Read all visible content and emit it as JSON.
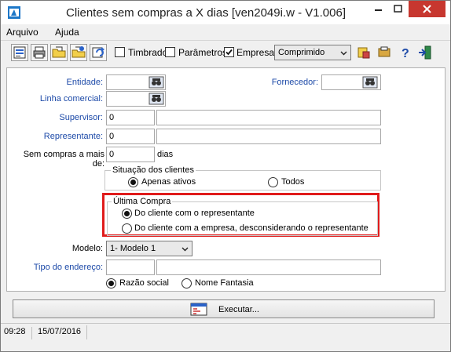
{
  "window": {
    "title": "Clientes sem compras a X dias [ven2049i.w - V1.006]"
  },
  "menu": {
    "items": [
      "Arquivo",
      "Ajuda"
    ]
  },
  "toolbar": {
    "timbrado_label": "Timbrado",
    "timbrado_checked": false,
    "parametros_label": "Parâmetros",
    "parametros_checked": false,
    "empresa_label": "Empresa",
    "empresa_checked": true,
    "format_select": "Comprimido"
  },
  "form": {
    "entidade_label": "Entidade:",
    "entidade_value": "",
    "fornecedor_label": "Fornecedor:",
    "fornecedor_value": "",
    "linha_label": "Linha comercial:",
    "linha_value": "",
    "supervisor_label": "Supervisor:",
    "supervisor_value": "0",
    "supervisor_desc": "",
    "representante_label": "Representante:",
    "representante_value": "0",
    "representante_desc": "",
    "sem_compras_label": "Sem compras a mais de:",
    "sem_compras_value": "0",
    "dias_label": "dias",
    "situacao_title": "Situação dos clientes",
    "situacao_options": [
      "Apenas ativos",
      "Todos"
    ],
    "ultima_title": "Última Compra",
    "ultima_options": [
      "Do cliente com o representante",
      "Do cliente com a empresa, desconsiderando o representante"
    ],
    "modelo_label": "Modelo:",
    "modelo_value": "1- Modelo 1",
    "tipo_endereco_label": "Tipo do endereço:",
    "tipo_endereco_value": "",
    "tipo_endereco_desc": "",
    "nome_options": [
      "Razão social",
      "Nome Fantasia"
    ]
  },
  "actions": {
    "executar_label": "Executar..."
  },
  "status": {
    "time": "09:28",
    "date": "15/07/2016"
  },
  "colors": {
    "highlight": "#e01b1b",
    "label_blue": "#1d4aa8",
    "close_button": "#c7372f"
  }
}
